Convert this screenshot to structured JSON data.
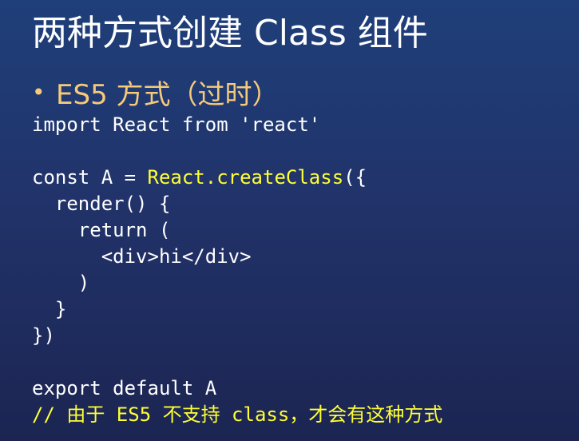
{
  "slide": {
    "title": "两种方式创建 Class 组件",
    "bullet": {
      "marker": "•",
      "text": "ES5 方式（过时）"
    },
    "code_lines": [
      [
        {
          "text": "import React from 'react'",
          "style": "plain"
        }
      ],
      [],
      [
        {
          "text": "const A = ",
          "style": "plain"
        },
        {
          "text": "React.createClass",
          "style": "yellow"
        },
        {
          "text": "({",
          "style": "plain"
        }
      ],
      [
        {
          "text": "  render() {",
          "style": "plain"
        }
      ],
      [
        {
          "text": "    return (",
          "style": "plain"
        }
      ],
      [
        {
          "text": "      <div>hi</div>",
          "style": "plain"
        }
      ],
      [
        {
          "text": "    )",
          "style": "plain"
        }
      ],
      [
        {
          "text": "  }",
          "style": "plain"
        }
      ],
      [
        {
          "text": "})",
          "style": "plain"
        }
      ],
      [],
      [
        {
          "text": "export default A",
          "style": "plain"
        }
      ],
      [
        {
          "text": "// 由于 ES5 不支持 class，才会有这种方式",
          "style": "yellow"
        }
      ]
    ]
  },
  "colors": {
    "title": "#ffffff",
    "bullet": "#f5ca7a",
    "code": "#ffffff",
    "highlight": "#ffff33"
  }
}
